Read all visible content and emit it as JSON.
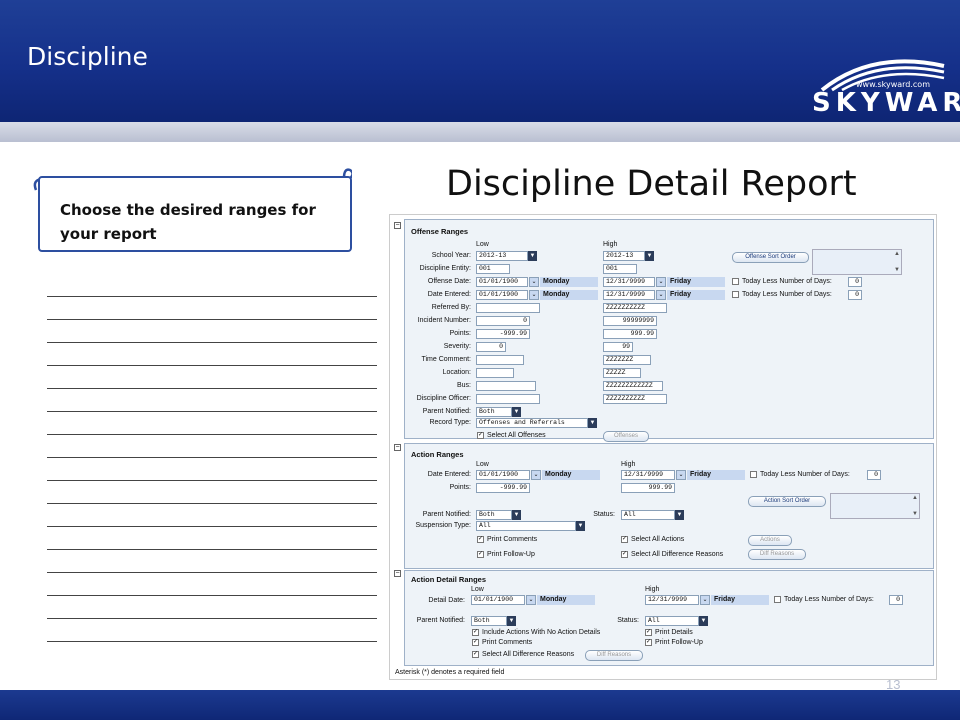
{
  "header": {
    "title": "Discipline",
    "logo_url": "www.skyward.com",
    "logo_word": "SKYWARD",
    "logo_mark": "®"
  },
  "callout": {
    "line1": "Choose  the desired ranges for",
    "line2": "your report"
  },
  "report_title": "Discipline Detail Report",
  "page_number": "13",
  "offense": {
    "title": "Offense Ranges",
    "low": "Low",
    "high": "High",
    "labels": [
      "School Year:",
      "Discipline Entity:",
      "Offense Date:",
      "Date Entered:",
      "Referred By:",
      "Incident Number:",
      "Points:",
      "Severity:",
      "Time Comment:",
      "Location:",
      "Bus:",
      "Discipline Officer:",
      "Parent Notified:",
      "Record Type:"
    ],
    "school_year_low": "2012-13",
    "school_year_high": "2012-13",
    "entity_low": "001",
    "entity_high": "001",
    "offense_date_low": "01/01/1900",
    "offense_date_low_day": "Monday",
    "offense_date_high": "12/31/9999",
    "offense_date_high_day": "Friday",
    "entered_low": "01/01/1900",
    "entered_low_day": "Monday",
    "entered_high": "12/31/9999",
    "entered_high_day": "Friday",
    "referred_high": "ZZZZZZZZZZ",
    "incident_low": "0",
    "incident_high": "99999999",
    "points_low": "-999.99",
    "points_high": "999.99",
    "severity_low": "0",
    "severity_high": "99",
    "time_comment_high": "ZZZZZZZ",
    "location_high": "ZZZZZ",
    "bus_high": "ZZZZZZZZZZZZ",
    "officer_high": "ZZZZZZZZZZ",
    "parent_notified": "Both",
    "record_type": "Offenses and Referrals",
    "sort_button": "Offense Sort Order",
    "today_less_label": "Today Less Number of Days:",
    "today_less_1": "0",
    "today_less_2": "0",
    "select_all": "Select All Offenses",
    "offenses_button": "Offenses"
  },
  "action": {
    "title": "Action Ranges",
    "low": "Low",
    "high": "High",
    "labels": [
      "Date Entered:",
      "Points:",
      "Parent Notified:",
      "Suspension Type:",
      "Status:"
    ],
    "entered_low": "01/01/1900",
    "entered_low_day": "Monday",
    "entered_high": "12/31/9999",
    "entered_high_day": "Friday",
    "today_less_label": "Today Less Number of Days:",
    "today_less": "0",
    "points_low": "-999.99",
    "points_high": "999.99",
    "sort_button": "Action Sort Order",
    "parent_notified": "Both",
    "status": "All",
    "suspension_type": "All",
    "print_comments": "Print Comments",
    "select_all_actions": "Select All Actions",
    "actions_button": "Actions",
    "print_followup": "Print Follow-Up",
    "select_all_diff": "Select All Difference Reasons",
    "diff_button": "Diff Reasons"
  },
  "detail": {
    "title": "Action Detail Ranges",
    "low": "Low",
    "high": "High",
    "labels": [
      "Detail Date:",
      "Parent Notified:",
      "Status:"
    ],
    "date_low": "01/01/1900",
    "date_low_day": "Monday",
    "date_high": "12/31/9999",
    "date_high_day": "Friday",
    "today_less_label": "Today Less Number of Days:",
    "today_less": "0",
    "parent_notified": "Both",
    "status": "All",
    "include_no_details": "Include Actions With No Action Details",
    "print_details": "Print Details",
    "print_comments": "Print Comments",
    "print_followup": "Print Follow-Up",
    "select_all_diff": "Select All Difference Reasons",
    "diff_button": "Diff Reasons"
  },
  "required_note": "Asterisk (*) denotes a required field"
}
